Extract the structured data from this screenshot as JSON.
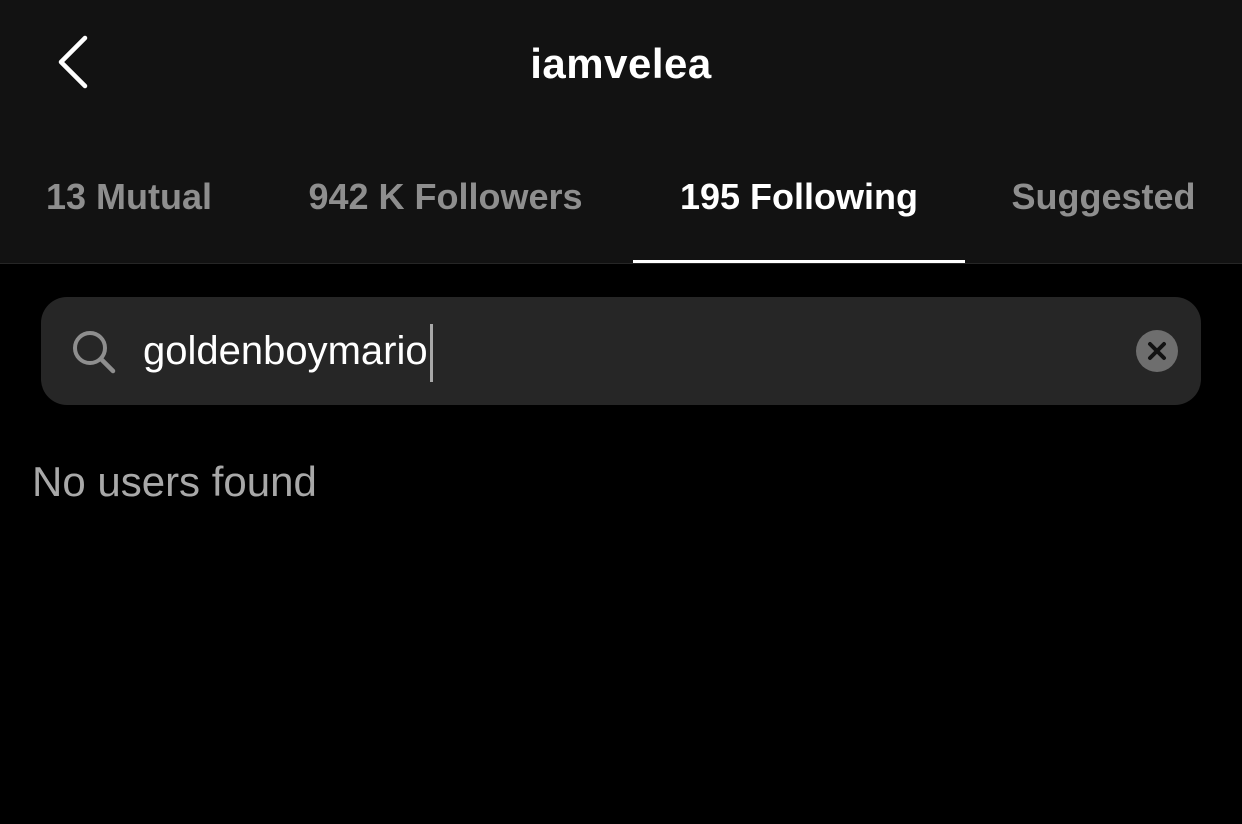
{
  "header": {
    "title": "iamvelea",
    "back_icon": "chevron-left-icon"
  },
  "tabs": [
    {
      "label": "13 Mutual",
      "active": false
    },
    {
      "label": "942 K Followers",
      "active": false
    },
    {
      "label": "195 Following",
      "active": true
    },
    {
      "label": "Suggested",
      "active": false
    }
  ],
  "search": {
    "value": "goldenboymario",
    "placeholder": "Search",
    "search_icon": "search-icon",
    "clear_icon": "clear-icon"
  },
  "results": {
    "empty_message": "No users found"
  },
  "colors": {
    "background": "#000000",
    "header_background": "#121212",
    "search_background": "#262626",
    "inactive_text": "#8e8e8e",
    "active_text": "#ffffff"
  }
}
